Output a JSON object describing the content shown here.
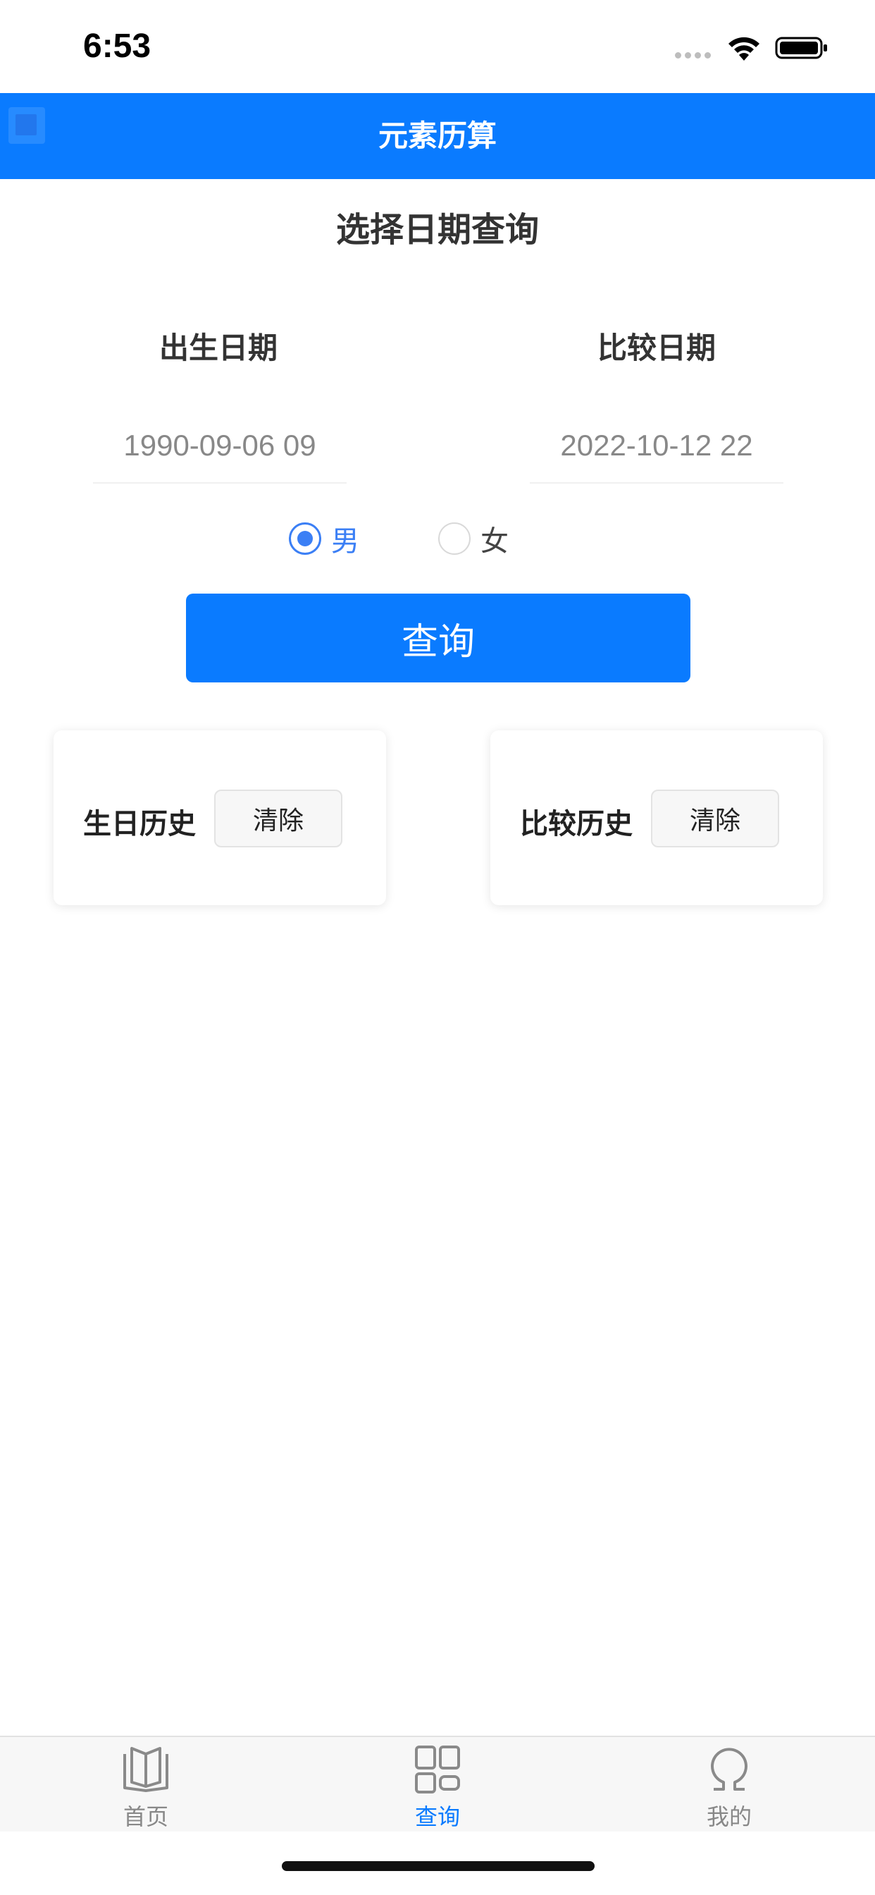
{
  "status_bar": {
    "time": "6:53"
  },
  "nav": {
    "title": "元素历算"
  },
  "page": {
    "title": "选择日期查询"
  },
  "birth": {
    "label": "出生日期",
    "value": "1990-09-06 09"
  },
  "compare": {
    "label": "比较日期",
    "value": "2022-10-12 22"
  },
  "gender": {
    "options": [
      {
        "label": "男",
        "checked": true
      },
      {
        "label": "女",
        "checked": false
      }
    ]
  },
  "query_button": {
    "label": "查询"
  },
  "history": [
    {
      "label": "生日历史",
      "clear_label": "清除"
    },
    {
      "label": "比较历史",
      "clear_label": "清除"
    }
  ],
  "tab_bar": {
    "items": [
      {
        "label": "首页",
        "icon": "book-icon",
        "active": false
      },
      {
        "label": "查询",
        "icon": "grid-icon",
        "active": true
      },
      {
        "label": "我的",
        "icon": "omega-icon",
        "active": false
      }
    ]
  },
  "colors": {
    "accent": "#0a7bff",
    "radio": "#3b7ff5",
    "inactive_tab": "#888888"
  }
}
